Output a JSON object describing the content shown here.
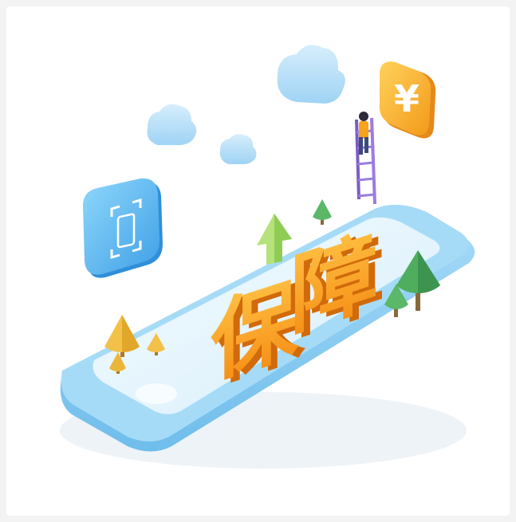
{
  "illustration": {
    "headline_char_1": "保",
    "headline_char_2": "障",
    "currency_symbol": "¥",
    "colors": {
      "phone_body": "#8fd0f5",
      "phone_screen": "#e9f6fd",
      "headline": "#f7a21b",
      "headline_dark": "#e07a10",
      "cloud": "#bfe3f8",
      "tree_green": "#4fae5e",
      "tree_yellow": "#f2c14a",
      "ladder": "#8a6bd1",
      "coin_badge": "#f9b233"
    },
    "icons": [
      "cloud-icon",
      "yen-badge-icon",
      "scan-badge-icon",
      "ladder-icon",
      "person-icon",
      "tree-icon",
      "arrow-up-icon",
      "home-button-icon"
    ]
  }
}
